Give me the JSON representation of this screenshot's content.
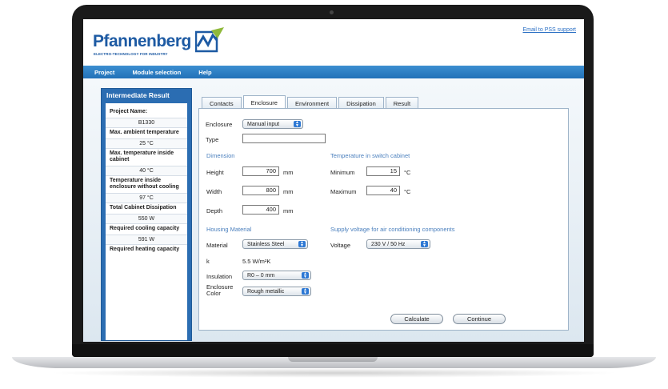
{
  "header": {
    "logo_text": "Pfannenberg",
    "logo_subtitle": "ELECTRO-TECHNOLOGY FOR INDUSTRY",
    "support_link": "Email to PSS support"
  },
  "menu": [
    "Project",
    "Module selection",
    "Help"
  ],
  "sidebar": {
    "title": "Intermediate Result",
    "items": [
      {
        "label": "Project Name:",
        "value": "B1330"
      },
      {
        "label": "Max. ambient temperature",
        "value": "25 °C"
      },
      {
        "label": "Max. temperature inside cabinet",
        "value": "40 °C"
      },
      {
        "label": "Temperature inside enclosure without cooling",
        "value": "97 °C"
      },
      {
        "label": "Total Cabinet Dissipation",
        "value": "550 W"
      },
      {
        "label": "Required cooling capacity",
        "value": "591 W"
      },
      {
        "label": "Required heating capacity",
        "value": ""
      }
    ]
  },
  "tabs": [
    {
      "label": "Contacts",
      "active": false
    },
    {
      "label": "Enclosure",
      "active": true
    },
    {
      "label": "Environment",
      "active": false
    },
    {
      "label": "Dissipation",
      "active": false
    },
    {
      "label": "Result",
      "active": false
    }
  ],
  "form": {
    "enclosure_label": "Enclosure",
    "enclosure_value": "Manual input",
    "type_label": "Type",
    "type_value": "",
    "dimension_title": "Dimension",
    "height_label": "Height",
    "height_value": "700",
    "height_unit": "mm",
    "width_label": "Width",
    "width_value": "800",
    "width_unit": "mm",
    "depth_label": "Depth",
    "depth_value": "400",
    "depth_unit": "mm",
    "temp_title": "Temperature in switch cabinet",
    "min_label": "Minimum",
    "min_value": "15",
    "min_unit": "°C",
    "max_label": "Maximum",
    "max_value": "40",
    "max_unit": "°C",
    "housing_title": "Housing Material",
    "material_label": "Material",
    "material_value": "Stainless Steel",
    "k_label": "k",
    "k_value": "5.5 W/m²K",
    "insulation_label": "Insulation",
    "insulation_value": "R0 – 0 mm",
    "color_label_1": "Enclosure",
    "color_label_2": "Color",
    "color_value": "Rough metallic",
    "supply_title": "Supply voltage for air conditioning components",
    "voltage_label": "Voltage",
    "voltage_value": "230 V / 50 Hz"
  },
  "buttons": {
    "calculate": "Calculate",
    "continue": "Continue"
  },
  "colors": {
    "brand": "#1d5aa3",
    "menu": "#2271b8",
    "section": "#4a7fbd"
  }
}
